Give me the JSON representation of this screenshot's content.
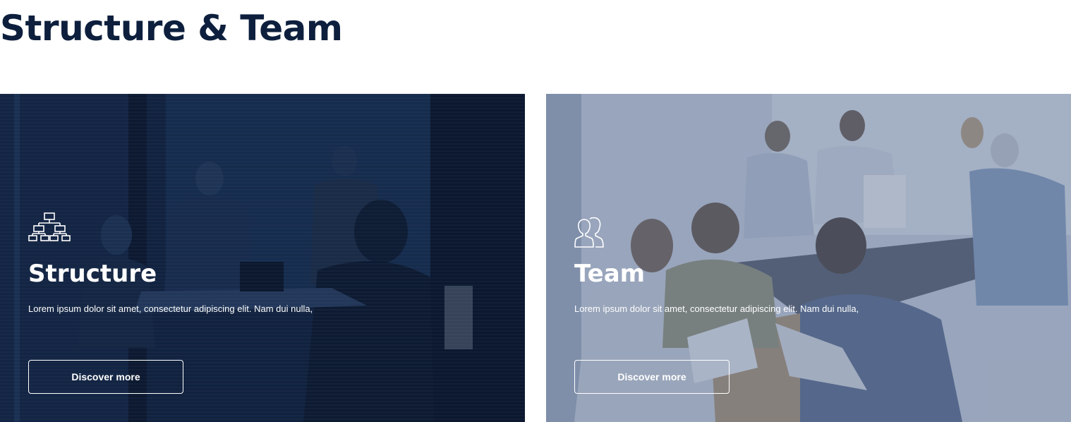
{
  "page": {
    "title": "Structure & Team"
  },
  "cards": [
    {
      "title": "Structure",
      "icon": "org-chart-icon",
      "text": "Lorem ipsum dolor sit amet, consectetur adipiscing elit. Nam dui nulla,",
      "button_label": "Discover more"
    },
    {
      "title": "Team",
      "icon": "users-icon",
      "text": "Lorem ipsum dolor sit amet, consectetur adipiscing elit. Nam dui nulla,",
      "button_label": "Discover more"
    }
  ],
  "colors": {
    "title": "#0d1f3d",
    "structure_overlay": "#0d1b34",
    "team_overlay": "#5f7396"
  }
}
